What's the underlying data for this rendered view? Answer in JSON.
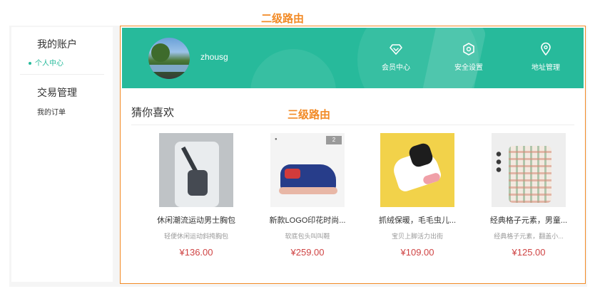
{
  "annotations": {
    "level2": "二级路由",
    "level3": "三级路由"
  },
  "sidebar": {
    "account_title": "我的账户",
    "personal_center": "个人中心",
    "trade_title": "交易管理",
    "my_orders": "我的订单"
  },
  "banner": {
    "username": "zhousg",
    "nav": [
      {
        "label": "会员中心",
        "icon": "diamond-icon"
      },
      {
        "label": "安全设置",
        "icon": "shield-icon"
      },
      {
        "label": "地址管理",
        "icon": "location-pin-icon"
      }
    ]
  },
  "recommend": {
    "title": "猜你喜欢",
    "products": [
      {
        "name": "休闲潮流运动男士胸包",
        "desc": "轻便休闲运动斜挎胸包",
        "price": "¥136.00"
      },
      {
        "name": "新款LOGO印花时尚...",
        "desc": "软底包头叫叫鞋",
        "price": "¥259.00"
      },
      {
        "name": "抓绒保暖，毛毛虫儿...",
        "desc": "宝贝上脚活力出街",
        "price": "¥109.00"
      },
      {
        "name": "经典格子元素，男童...",
        "desc": "经典格子元素，翻盖小...",
        "price": "¥125.00"
      }
    ]
  },
  "colors": {
    "brand": "#27ba9b",
    "price": "#cf4444",
    "annotation": "#f28a25"
  }
}
